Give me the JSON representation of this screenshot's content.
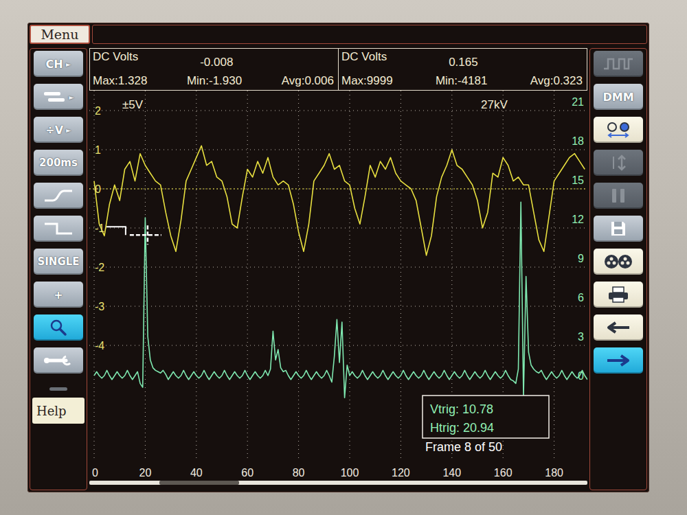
{
  "menu": {
    "label": "Menu"
  },
  "left_toolbar": [
    {
      "kind": "text",
      "label": "CH",
      "arrow": "►",
      "selected": false,
      "disabled": false,
      "lit": false
    },
    {
      "kind": "icon",
      "arrow": "►",
      "selected": false,
      "disabled": false,
      "lit": false
    },
    {
      "kind": "text",
      "label": "÷V",
      "arrow": "►",
      "selected": false,
      "disabled": false,
      "lit": false
    },
    {
      "kind": "text",
      "label": "200ms",
      "selected": false,
      "disabled": false,
      "lit": false
    },
    {
      "kind": "icon",
      "selected": false,
      "disabled": false,
      "lit": false
    },
    {
      "kind": "icon",
      "selected": false,
      "disabled": false,
      "lit": false
    },
    {
      "kind": "text",
      "label": "SINGLE",
      "selected": false,
      "disabled": false,
      "lit": false
    },
    {
      "kind": "text",
      "label": "+",
      "selected": false,
      "disabled": false,
      "lit": false
    },
    {
      "kind": "icon",
      "selected": true,
      "disabled": false,
      "lit": false
    },
    {
      "kind": "icon",
      "selected": false,
      "disabled": false,
      "lit": false
    }
  ],
  "help": {
    "label": "Help"
  },
  "right_toolbar": [
    {
      "kind": "icon",
      "selected": false,
      "disabled": true,
      "lit": false
    },
    {
      "kind": "text",
      "label": "DMM",
      "selected": false,
      "disabled": false,
      "lit": false
    },
    {
      "kind": "icon",
      "selected": false,
      "disabled": false,
      "lit": true
    },
    {
      "kind": "icon",
      "selected": false,
      "disabled": true,
      "lit": false
    },
    {
      "kind": "icon",
      "selected": false,
      "disabled": true,
      "lit": false
    },
    {
      "kind": "icon",
      "selected": false,
      "disabled": false,
      "lit": false
    },
    {
      "kind": "icon",
      "selected": false,
      "disabled": false,
      "lit": true
    },
    {
      "kind": "icon",
      "selected": false,
      "disabled": false,
      "lit": true
    },
    {
      "kind": "icon",
      "selected": false,
      "disabled": false,
      "lit": true
    },
    {
      "kind": "icon",
      "selected": true,
      "disabled": false,
      "lit": false
    }
  ],
  "readouts": [
    {
      "title": "DC Volts",
      "value": "-0.008",
      "max": "Max:1.328",
      "min": "Min:-1.930",
      "avg": "Avg:0.006"
    },
    {
      "title": "DC Volts",
      "value": "0.165",
      "max": "Max:9999",
      "min": "Min:-4181",
      "avg": "Avg:0.323"
    }
  ],
  "chart": {
    "scale_left": "±5V",
    "scale_right": "27kV",
    "y_left_ticks": [
      "2",
      "1",
      "0",
      "-1",
      "-2",
      "-3",
      "-4"
    ],
    "y_right_ticks": [
      "21",
      "18",
      "15",
      "12",
      "9",
      "6",
      "3",
      "0"
    ],
    "x_ticks": [
      "0",
      "20",
      "40",
      "60",
      "80",
      "100",
      "120",
      "140",
      "160",
      "180"
    ],
    "series": [
      {
        "unit": "V",
        "axis": "left",
        "color": "#e8e040",
        "t_step_ms": 2,
        "values": [
          0.2,
          -0.9,
          -1.2,
          -0.4,
          0.1,
          -0.3,
          0.5,
          0.7,
          0.2,
          0.9,
          0.6,
          0.4,
          0.2,
          0.1,
          -0.6,
          -1.2,
          -1.6,
          -0.8,
          0.2,
          0.5,
          0.8,
          1.1,
          0.6,
          0.7,
          0.3,
          0.2,
          -0.2,
          -0.9,
          -1.0,
          -0.2,
          0.5,
          0.3,
          0.7,
          0.4,
          0.8,
          0.3,
          0.1,
          0.2,
          0.1,
          -0.4,
          -1.1,
          -1.6,
          -0.9,
          0.2,
          0.4,
          0.6,
          0.9,
          0.5,
          0.6,
          0.2,
          0.1,
          -0.5,
          -0.9,
          -0.2,
          0.6,
          0.3,
          0.7,
          0.5,
          0.8,
          0.4,
          0.2,
          0.1,
          0.0,
          -0.3,
          -1.0,
          -1.7,
          -1.2,
          -0.2,
          0.3,
          0.6,
          1.0,
          0.6,
          0.5,
          0.3,
          0.1,
          -0.3,
          -1.0,
          -0.6,
          0.4,
          0.3,
          0.8,
          0.6,
          0.2,
          0.3,
          0.1,
          0.1,
          -0.6,
          -1.3,
          -1.6,
          -0.7,
          0.2,
          0.4,
          0.6,
          0.8,
          0.9,
          0.7,
          0.5
        ]
      },
      {
        "unit": "kV",
        "axis": "right",
        "color": "#7fe8b0",
        "t_step_ms": 1,
        "values": [
          0,
          0.3,
          0,
          -0.2,
          0,
          0.4,
          0,
          -0.3,
          0,
          0.3,
          0,
          -0.2,
          0,
          0.4,
          0,
          -0.3,
          0,
          0.3,
          -0.6,
          -0.9,
          12.1,
          3.0,
          1.2,
          0.6,
          0.4,
          0.3,
          0.2,
          0.4,
          0.1,
          -0.3,
          0,
          0.3,
          0,
          -0.2,
          0,
          0.4,
          0,
          -0.3,
          0,
          0.3,
          0,
          -0.2,
          0,
          0.4,
          0,
          -0.3,
          0,
          0.3,
          0,
          -0.2,
          0,
          0.4,
          0,
          -0.3,
          0,
          0.3,
          0,
          -0.2,
          0,
          0.4,
          0,
          -0.3,
          0,
          0.3,
          0,
          -0.2,
          0,
          0.4,
          0,
          0.5,
          3.4,
          1.2,
          2.0,
          0.6,
          0.3,
          0.4,
          0,
          -0.3,
          0,
          0.3,
          0,
          -0.2,
          0,
          0.4,
          0,
          -0.3,
          0,
          0.3,
          0,
          -0.2,
          0,
          0.4,
          0,
          -0.5,
          1.5,
          4.3,
          1.0,
          4.1,
          -1.7,
          0.8,
          0,
          0.3,
          0,
          -0.2,
          0,
          0.4,
          0,
          -0.3,
          0,
          0.3,
          0,
          -0.2,
          0,
          0.4,
          0,
          -0.3,
          0,
          0.3,
          0,
          -0.2,
          0,
          0.4,
          0,
          -0.3,
          0,
          0.3,
          0,
          -0.2,
          0,
          0.4,
          0,
          -0.3,
          0,
          0.3,
          0,
          -0.2,
          0,
          0.4,
          0,
          -0.3,
          0,
          0.3,
          0,
          -0.2,
          0,
          0.4,
          0,
          -0.3,
          0,
          0.3,
          0,
          -0.2,
          0,
          0.4,
          0,
          -0.3,
          0,
          0.3,
          0,
          -0.2,
          0,
          0.4,
          0,
          -0.3,
          -0.4,
          -0.6,
          0.5,
          13.3,
          -1.6,
          7.6,
          1.8,
          0.8,
          0.5,
          0.3,
          0.2,
          0.4,
          0,
          -0.3,
          0,
          0.3,
          0,
          -0.2,
          0,
          0.4,
          0,
          -0.3,
          0,
          0.3,
          0,
          -0.2,
          0,
          0.4,
          0,
          -0.3
        ]
      }
    ]
  },
  "trigger": {
    "vtrig": "Vtrig: 10.78",
    "htrig": "Htrig: 20.94",
    "frame": "Frame 8 of 50",
    "level": 10.78,
    "time": 20.94
  },
  "scrollbar": {
    "start": 0.14,
    "size": 0.16
  }
}
